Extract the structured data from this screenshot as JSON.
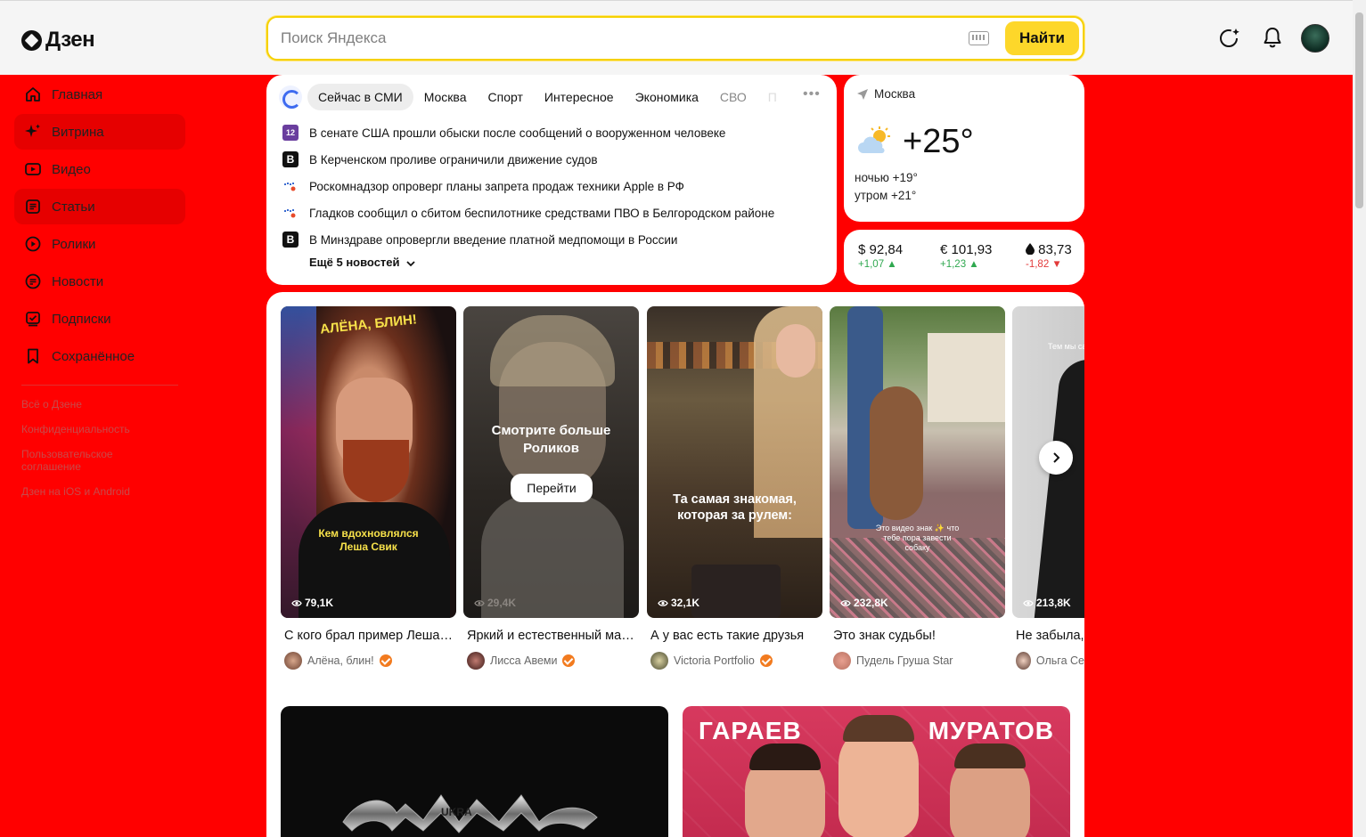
{
  "header": {
    "logo_text": "Дзен",
    "search_placeholder": "Поиск Яндекса",
    "search_button": "Найти"
  },
  "sidebar": {
    "items": [
      {
        "label": "Главная",
        "icon": "home-icon"
      },
      {
        "label": "Витрина",
        "icon": "sparkle-icon"
      },
      {
        "label": "Видео",
        "icon": "video-icon"
      },
      {
        "label": "Статьи",
        "icon": "article-icon"
      },
      {
        "label": "Ролики",
        "icon": "shorts-icon"
      },
      {
        "label": "Новости",
        "icon": "news-icon"
      },
      {
        "label": "Подписки",
        "icon": "subscriptions-icon"
      },
      {
        "label": "Сохранённое",
        "icon": "bookmark-icon"
      }
    ],
    "footer_links": [
      "Всё о Дзене",
      "Конфиденциальность",
      "Пользовательское соглашение",
      "Дзен на iOS и Android"
    ]
  },
  "news": {
    "tabs": [
      "Сейчас в СМИ",
      "Москва",
      "Спорт",
      "Интересное",
      "Экономика",
      "СВО",
      "П"
    ],
    "items": [
      {
        "source": "purple",
        "source_label": "12",
        "text": "В сенате США прошли обыски после сообщений о вооруженном человеке"
      },
      {
        "source": "black",
        "source_label": "B",
        "text": "В Керченском проливе ограничили движение судов"
      },
      {
        "source": "mir",
        "source_label": "",
        "text": "Роскомнадзор опроверг планы запрета продаж техники Apple в РФ"
      },
      {
        "source": "mir",
        "source_label": "",
        "text": "Гладков сообщил о сбитом беспилотнике средствами ПВО в Белгородском районе"
      },
      {
        "source": "black",
        "source_label": "B",
        "text": "В Минздраве опровергли введение платной медпомощи в России"
      }
    ],
    "more_label": "Ещё 5 новостей"
  },
  "weather": {
    "city": "Москва",
    "temp": "+25°",
    "night": "ночью +19°",
    "morning": "утром +21°"
  },
  "currency": [
    {
      "value": "$ 92,84",
      "delta": "+1,07",
      "dir": "up"
    },
    {
      "value": "€ 101,93",
      "delta": "+1,23",
      "dir": "up"
    },
    {
      "value": "83,73",
      "delta": "-1,82",
      "dir": "down"
    }
  ],
  "shorts": [
    {
      "title": "С кого брал пример Леша Свик",
      "author": "Алёна, блин!",
      "views": "79,1K",
      "caption": "Кем вдохновлялся Леша Свик",
      "top_caption": "АЛЁНА, БЛИН!"
    },
    {
      "title": "Яркий и естественный макияж",
      "author": "Лисса Авеми",
      "views": "29,4K",
      "promo_title": "Смотрите больше Роликов",
      "promo_button": "Перейти"
    },
    {
      "title": "А у вас есть такие друзья",
      "author": "Victoria Portfolio",
      "views": "32,1K",
      "caption": "Та самая знакомая, которая за рулем:"
    },
    {
      "title": "Это знак судьбы!",
      "author": "Пудель Груша Star",
      "views": "232,8K",
      "caption": "Это видео знак ✨ что тебе пора завести собаку"
    },
    {
      "title": "Не забыла,",
      "author": "Ольга Се",
      "views": "213,8K",
      "caption": "Тем мы самое"
    }
  ],
  "featured": {
    "left_logo": "UKRA",
    "right_name_left": "ГАРАЕВ",
    "right_name_right": "МУРАТОВ"
  },
  "colors": {
    "page_bg": "#ff0000",
    "accent_yellow": "#fdd72a",
    "verified": "#f27b1f"
  }
}
